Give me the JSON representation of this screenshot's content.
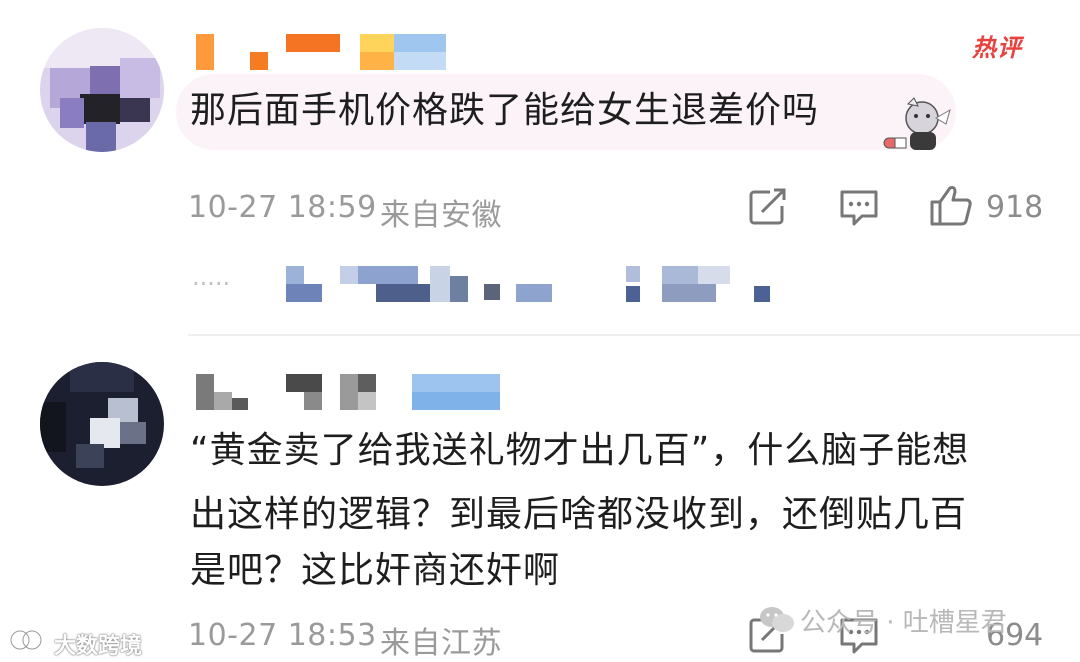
{
  "hot_badge": "热评",
  "comment1": {
    "text": "那后面手机价格跌了能给女生退差价吗",
    "time": "10-27 18:59",
    "location": "来自安徽",
    "likes": "918"
  },
  "reply_dots": "·····",
  "comment2": {
    "line1": "“黄金卖了给我送礼物才出几百”，什么脑子能想",
    "line2": "出这样的逻辑？到最后啥都没收到，还倒贴几百",
    "line3": "是吧？这比奸商还奸啊",
    "time": "10-27 18:53",
    "location": "来自江苏",
    "likes": "694"
  },
  "watermark": {
    "right": "公众号 · 吐槽星君",
    "left": "大数跨境"
  },
  "colors": {
    "accent_red": "#e8423e",
    "meta_gray": "#9a9a9a",
    "bubble_pink": "#fbf3f8"
  },
  "icons": [
    "repost-icon",
    "comment-icon",
    "like-icon",
    "sticker-icon"
  ]
}
